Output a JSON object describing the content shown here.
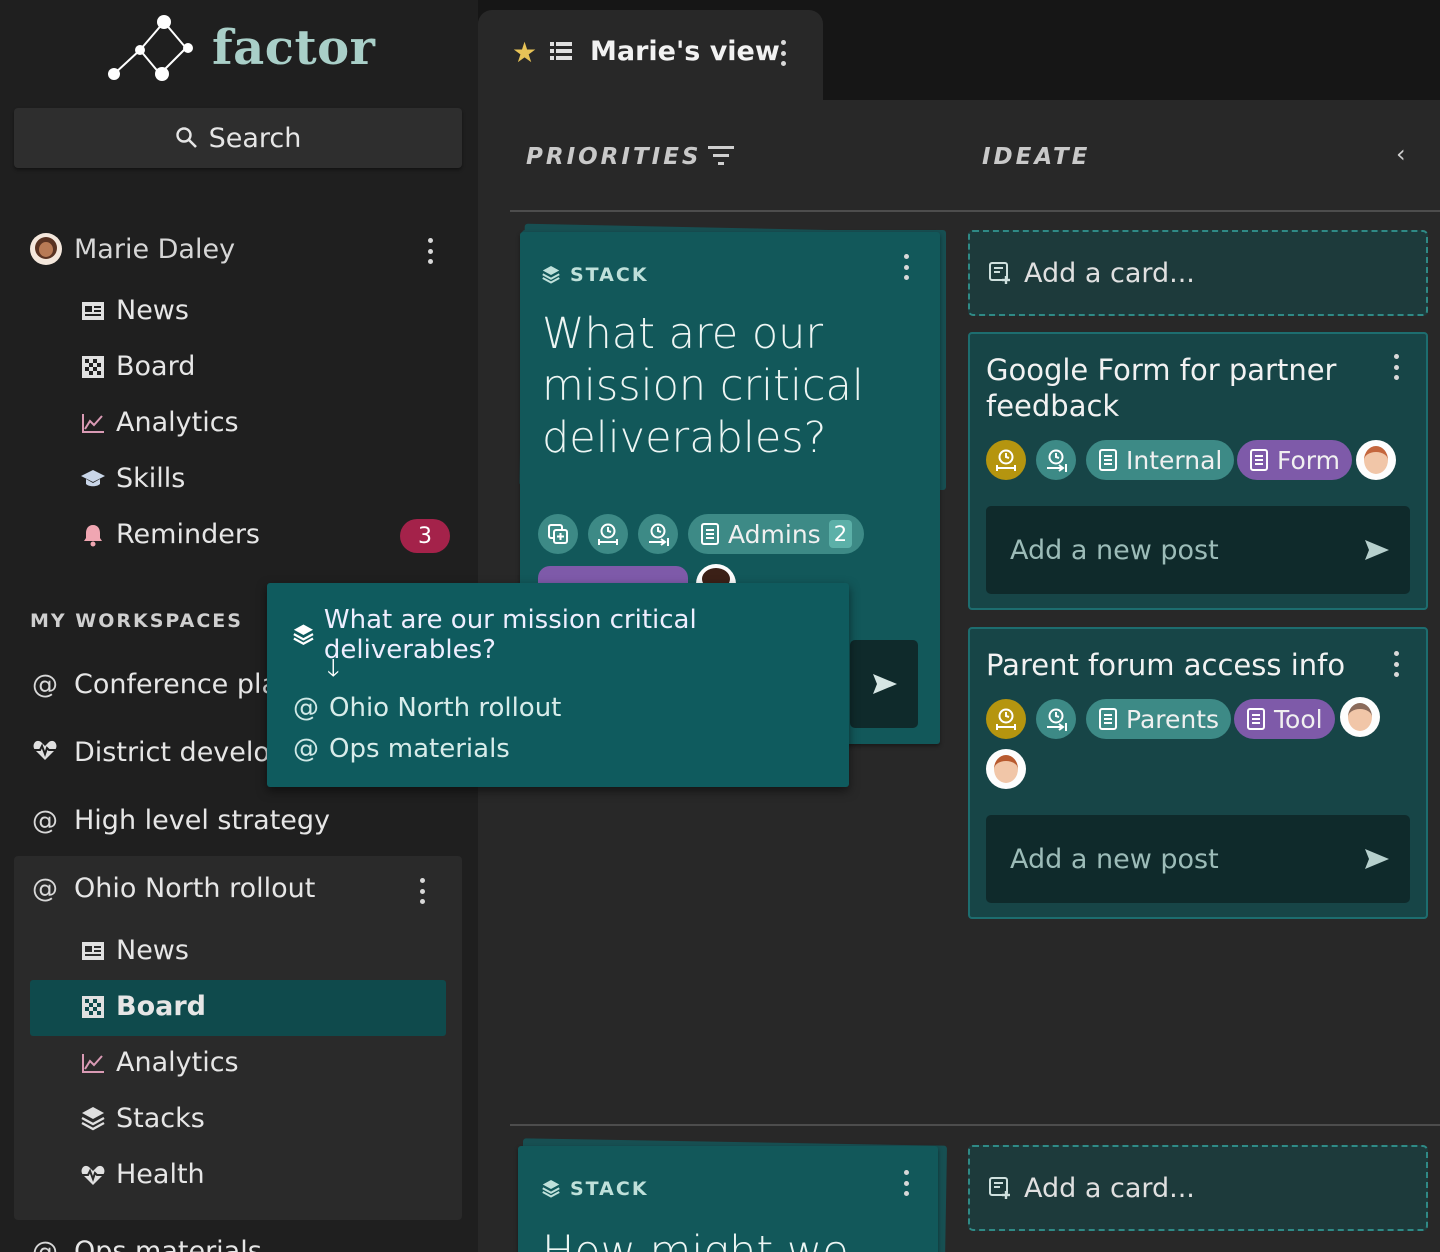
{
  "app": {
    "name": "factor"
  },
  "search": {
    "label": "Search"
  },
  "user": {
    "name": "Marie Daley",
    "items": [
      {
        "label": "News",
        "icon": "newspaper-icon"
      },
      {
        "label": "Board",
        "icon": "board-icon"
      },
      {
        "label": "Analytics",
        "icon": "chart-icon"
      },
      {
        "label": "Skills",
        "icon": "mortarboard-icon"
      },
      {
        "label": "Reminders",
        "icon": "bell-icon",
        "badge": "3"
      }
    ]
  },
  "workspaces": {
    "label": "MY WORKSPACES",
    "items": [
      {
        "label": "Conference planning",
        "visible": "Conference plar"
      },
      {
        "label": "District development",
        "visible": "District develop"
      },
      {
        "label": "High level strategy"
      },
      {
        "label": "Ohio North rollout"
      }
    ],
    "ohio_items": [
      {
        "label": "News"
      },
      {
        "label": "Board",
        "active": true
      },
      {
        "label": "Analytics"
      },
      {
        "label": "Stacks"
      },
      {
        "label": "Health"
      }
    ],
    "next": "Ops materials"
  },
  "tab": {
    "title": "Marie's view"
  },
  "columns": {
    "left": "PRIORITIES",
    "right": "IDEATE"
  },
  "stack1": {
    "label": "STACK",
    "title_lines": [
      "What are our",
      "mission critical",
      "deliverables?"
    ],
    "chip_admins": "Admins",
    "chip_admins_count": "2"
  },
  "stack2": {
    "label": "STACK",
    "title": "How might we"
  },
  "ideate": {
    "add_card": "Add a card...",
    "card1": {
      "title_lines": [
        "Google Form for partner",
        "feedback"
      ],
      "chip1": "Internal",
      "chip2": "Form",
      "post": "Add a new post"
    },
    "card2": {
      "title": "Parent forum access info",
      "chip1": "Parents",
      "chip2": "Tool",
      "post": "Add a new post"
    },
    "add_card2": "Add a card..."
  },
  "popover": {
    "title": "What are our mission critical deliverables?",
    "items": [
      "Ohio North rollout",
      "Ops materials"
    ]
  },
  "colors": {
    "teal_card": "#12585a",
    "accent": "#3d8a86",
    "purple": "#7e5aa9",
    "gold": "#b5950f",
    "badge": "#a4224a"
  }
}
